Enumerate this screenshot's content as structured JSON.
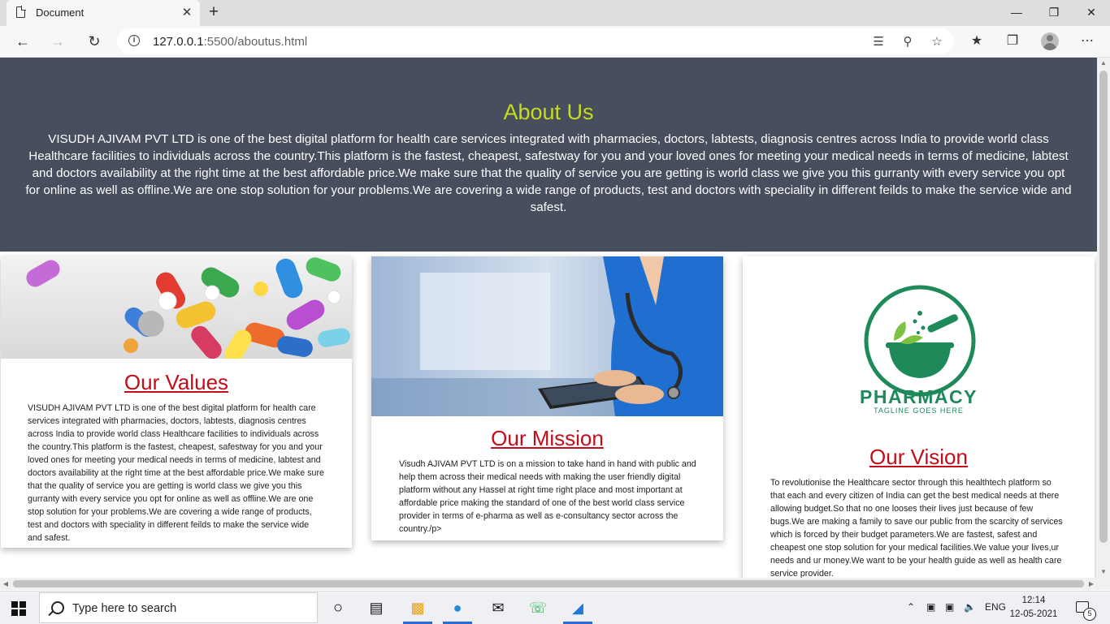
{
  "browser": {
    "tab_title": "Document",
    "url_host": "127.0.0.1",
    "url_path": ":5500/aboutus.html"
  },
  "hero": {
    "title": "About Us",
    "text": "VISUDH AJIVAM PVT LTD is one of the best digital platform for health care services integrated with pharmacies, doctors, labtests, diagnosis centres across India to provide world class Healthcare facilities to individuals across the country.This platform is the fastest, cheapest, safestway for you and your loved ones for meeting your medical needs in terms of medicine, labtest and doctors availability at the right time at the best affordable price.We make sure that the quality of service you are getting is world class we give you this gurranty with every service you opt for online as well as offline.We are one stop solution for your problems.We are covering a wide range of products, test and doctors with speciality in different feilds to make the service wide and safest."
  },
  "cards": {
    "values": {
      "title": "Our Values",
      "text": "VISUDH AJIVAM PVT LTD is one of the best digital platform for health care services integrated with pharmacies, doctors, labtests, diagnosis centres across India to provide world class Healthcare facilities to individuals across the country.This platform is the fastest, cheapest, safestway for you and your loved ones for meeting your medical needs in terms of medicine, labtest and doctors availability at the right time at the best affordable price.We make sure that the quality of service you are getting is world class we give you this gurranty with every service you opt for online as well as offline.We are one stop solution for your problems.We are covering a wide range of products, test and doctors with speciality in different feilds to make the service wide and safest."
    },
    "mission": {
      "title": "Our Mission",
      "text": "Visudh AJIVAM PVT LTD is on a mission to take hand in hand with public and help them across their medical needs with making the user friendly digital platform without any Hassel at right time right place and most important at affordable price making the standard of one of the best world class service provider in terms of e-pharma as well as e-consultancy sector across the country./p>"
    },
    "vision": {
      "title": "Our Vision",
      "logo_text": "PHARMACY",
      "logo_tagline": "TAGLINE GOES HERE",
      "text": "To revolutionise the Healthcare sector through this healthtech platform so that each and every citizen of India can get the best medical needs at there allowing budget.So that no one looses their lives just because of few bugs.We are making a family to save our public from the scarcity of services which is forced by their budget parameters.We are fastest, safest and cheapest one stop solution for your medical facilities.We value your lives,ur needs and ur money.We want to be your health guide as well as health care service provider."
    }
  },
  "taskbar": {
    "search_placeholder": "Type here to search",
    "language": "ENG",
    "time": "12:14",
    "date": "12-05-2021",
    "notification_count": "5"
  },
  "colors": {
    "hero_bg": "#474e5d",
    "hero_title": "#c7dc1c",
    "card_title": "#c20d1a",
    "logo_green": "#1e8a5a"
  }
}
